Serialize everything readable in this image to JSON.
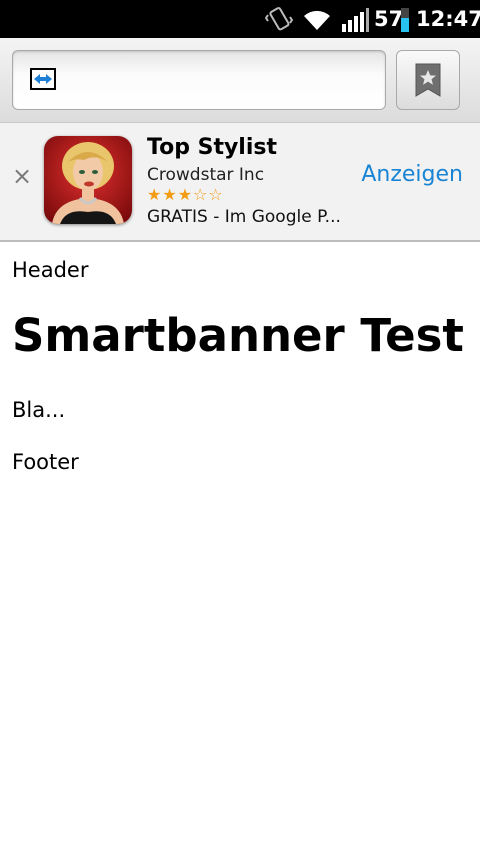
{
  "status_bar": {
    "battery": "57",
    "time": "12:47",
    "icons": [
      "vibrate-icon",
      "wifi-icon",
      "signal-icon",
      "battery-icon"
    ]
  },
  "browser": {
    "url": "",
    "icons": [
      "favicon-icon",
      "bookmark-icon"
    ]
  },
  "smart_banner": {
    "close_label": "×",
    "app_title": "Top Stylist",
    "developer": "Crowdstar Inc",
    "rating": 3.5,
    "rating_max": 5,
    "stars_text": "★★★☆☆",
    "price_text": "GRATIS - Im Google P...",
    "view_button": "Anzeigen",
    "accent_color": "#1a84d4",
    "star_color": "#f39c12"
  },
  "page": {
    "header": "Header",
    "title": "Smartbanner Test",
    "body": "Bla...",
    "footer": "Footer"
  }
}
